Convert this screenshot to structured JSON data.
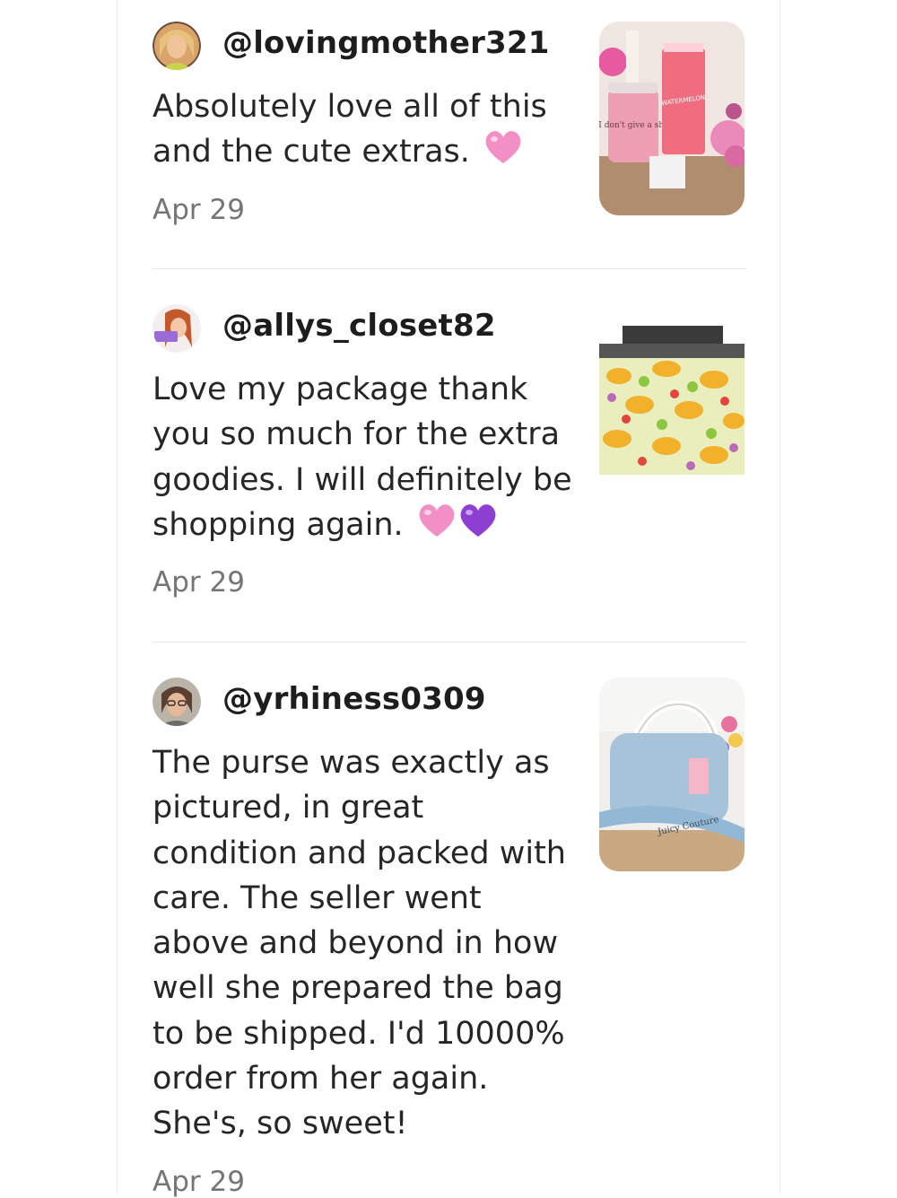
{
  "reviews": [
    {
      "handle": "@lovingmother321",
      "text": "Absolutely love all of this and the cute extras.",
      "emoji": [
        "pink-heart"
      ],
      "date": "Apr 29",
      "thumbnail": "pink-tumbler-and-lotion-photo",
      "thumbnail_text": [
        "I don't give a sh*",
        "WATERMELON"
      ]
    },
    {
      "handle": "@allys_closet82",
      "text": "Love my package thank you so much for the extra goodies. I will definitely be shopping again.",
      "emoji": [
        "pink-heart",
        "purple-heart"
      ],
      "date": "Apr 29",
      "thumbnail": "taco-print-mailers-photo"
    },
    {
      "handle": "@yrhiness0309",
      "text": "The purse was exactly as pictured, in great condition and packed with care. The seller went above and beyond in how well she prepared the bag to be shipped. I'd 10000% order from her again. She's, so sweet!",
      "emoji": [],
      "date": "Apr 29",
      "thumbnail": "juicy-couture-purse-photo",
      "thumbnail_text": [
        "Juicy Couture"
      ]
    }
  ],
  "colors": {
    "handle": "#1d1d1d",
    "body_text": "#262626",
    "date": "#757575",
    "divider": "#e6e6e6",
    "pink_heart": "#f28fc4",
    "purple_heart": "#8d3fd1"
  }
}
